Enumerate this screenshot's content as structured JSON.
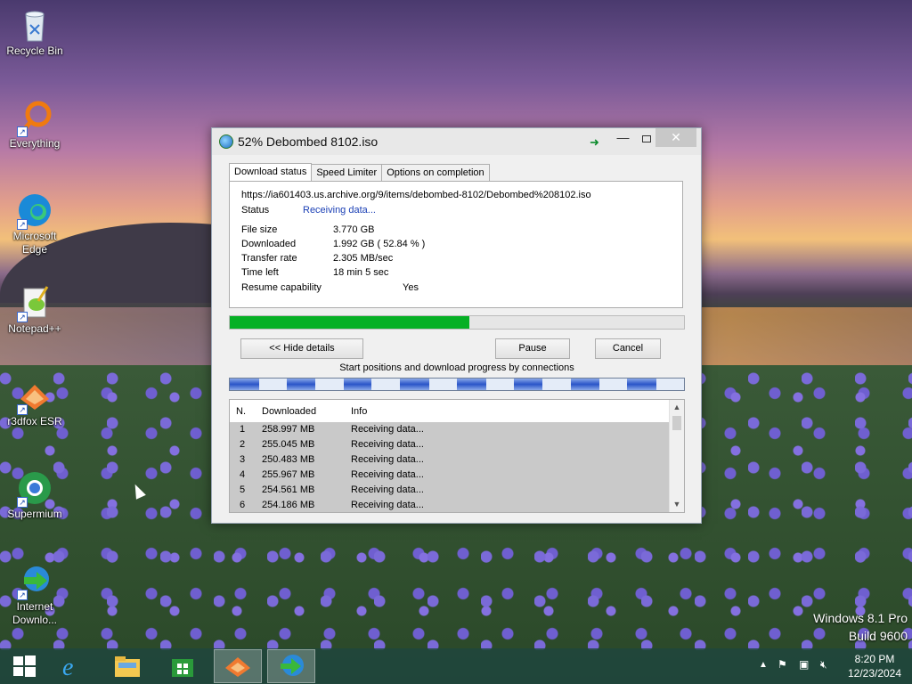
{
  "desktop": {
    "icons": [
      {
        "label": "Recycle Bin",
        "icon": "recycle-bin-icon"
      },
      {
        "label": "Everything",
        "icon": "search-magnifier-icon"
      },
      {
        "label": "Microsoft Edge",
        "icon": "edge-icon"
      },
      {
        "label": "Notepad++",
        "icon": "notepad-plus-plus-icon"
      },
      {
        "label": "r3dfox ESR",
        "icon": "r3dfox-icon"
      },
      {
        "label": "Supermium",
        "icon": "supermium-icon"
      },
      {
        "label": "Internet Downlo...",
        "icon": "idm-icon"
      }
    ],
    "watermark": {
      "line1": "Windows 8.1 Pro",
      "line2": "Build 9600"
    }
  },
  "window": {
    "title": "52% Debombed 8102.iso",
    "tabs": [
      "Download status",
      "Speed Limiter",
      "Options on completion"
    ],
    "url": "https://ia601403.us.archive.org/9/items/debombed-8102/Debombed%208102.iso",
    "status_label": "Status",
    "status_value": "Receiving data...",
    "file_size_label": "File size",
    "file_size_value": "3.770  GB",
    "downloaded_label": "Downloaded",
    "downloaded_value": "1.992  GB  ( 52.84 % )",
    "transfer_rate_label": "Transfer rate",
    "transfer_rate_value": "2.305  MB/sec",
    "time_left_label": "Time left",
    "time_left_value": "18 min 5 sec",
    "resume_label": "Resume capability",
    "resume_value": "Yes",
    "progress": 0.5284,
    "buttons": {
      "hide_details": "<< Hide details",
      "pause": "Pause",
      "cancel": "Cancel"
    },
    "connections_label": "Start positions and download progress by connections",
    "connection_progress": [
      0.52,
      0.51,
      0.5,
      0.51,
      0.51,
      0.51,
      0.51,
      0.52
    ],
    "table": {
      "columns": [
        "N.",
        "Downloaded",
        "Info"
      ],
      "rows": [
        {
          "n": "1",
          "downloaded": "258.997  MB",
          "info": "Receiving data..."
        },
        {
          "n": "2",
          "downloaded": "255.045  MB",
          "info": "Receiving data..."
        },
        {
          "n": "3",
          "downloaded": "250.483  MB",
          "info": "Receiving data..."
        },
        {
          "n": "4",
          "downloaded": "255.967  MB",
          "info": "Receiving data..."
        },
        {
          "n": "5",
          "downloaded": "254.561  MB",
          "info": "Receiving data..."
        },
        {
          "n": "6",
          "downloaded": "254.186  MB",
          "info": "Receiving data..."
        }
      ]
    }
  },
  "taskbar": {
    "items": [
      "start-icon",
      "internet-explorer-icon",
      "file-explorer-icon",
      "store-icon",
      "r3dfox-icon",
      "idm-icon"
    ],
    "clock_time": "8:20 PM",
    "clock_date": "12/23/2024"
  }
}
